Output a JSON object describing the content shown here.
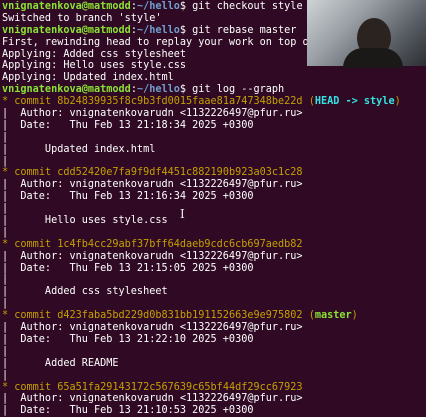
{
  "terminal": {
    "l1": {
      "user": "vnignatenkova@matmodd",
      "sep": ":",
      "path": "~/hello",
      "prompt": "$ ",
      "cmd": "git checkout style"
    },
    "l2": "Switched to branch 'style'",
    "l3": {
      "user": "vnignatenkova@matmodd",
      "sep": ":",
      "path": "~/hello",
      "prompt": "$ ",
      "cmd": "git rebase master"
    },
    "l4": "First, rewinding head to replay your work on top of",
    "l5": "Applying: Added css stylesheet",
    "l6": "Applying: Hello uses style.css",
    "l7": "Applying: Updated index.html",
    "l8": {
      "user": "vnignatenkova@matmodd",
      "sep": ":",
      "path": "~/hello",
      "prompt": "$ ",
      "cmd": "git log --graph"
    },
    "commits": [
      {
        "star": "* ",
        "hash": "commit 8b24839935f8c9b3fd0015faae81a747348be22d",
        "ref_open": " (",
        "ref_head": "HEAD -> style",
        "ref_close": ")",
        "author": "|  Author: vnignatenkovarudn <1132226497@pfur.ru>",
        "date": "|  Date:   Thu Feb 13 21:18:34 2025 +0300",
        "blank1": "|",
        "message": "|      Updated index.html",
        "blank2": "|"
      },
      {
        "star": "* ",
        "hash": "commit cdd52420e7fa9f9df4451c882190b923a03c1c28",
        "author": "|  Author: vnignatenkovarudn <1132226497@pfur.ru>",
        "date": "|  Date:   Thu Feb 13 21:16:34 2025 +0300",
        "blank1": "|",
        "message": "|      Hello uses style.css",
        "blank2": "|"
      },
      {
        "star": "* ",
        "hash": "commit 1c4fb4cc29abf37bff64daeb9cdc6cb697aedb82",
        "author": "|  Author: vnignatenkovarudn <1132226497@pfur.ru>",
        "date": "|  Date:   Thu Feb 13 21:15:05 2025 +0300",
        "blank1": "|",
        "message": "|      Added css stylesheet",
        "blank2": "|"
      },
      {
        "star": "* ",
        "hash": "commit d423faba5bd229d0b831bb191152663e9e975802",
        "ref_open": " (",
        "ref_branch": "master",
        "ref_close": ")",
        "author": "|  Author: vnignatenkovarudn <1132226497@pfur.ru>",
        "date": "|  Date:   Thu Feb 13 21:22:10 2025 +0300",
        "blank1": "|",
        "message": "|      Added README",
        "blank2": "|"
      },
      {
        "star": "* ",
        "hash": "commit 65a51fa29143172c567639c65bf44df29cc67923",
        "author": "|  Author: vnignatenkovarudn <1132226497@pfur.ru>",
        "date": "|  Date:   Thu Feb 13 21:10:53 2025 +0300"
      }
    ]
  },
  "colors": {
    "background": "#300a24",
    "user_host": "#8ae234",
    "path": "#729fcf",
    "commit_hash": "#c4a000",
    "head_ref": "#34e2e2",
    "branch_ref": "#8ae234"
  }
}
